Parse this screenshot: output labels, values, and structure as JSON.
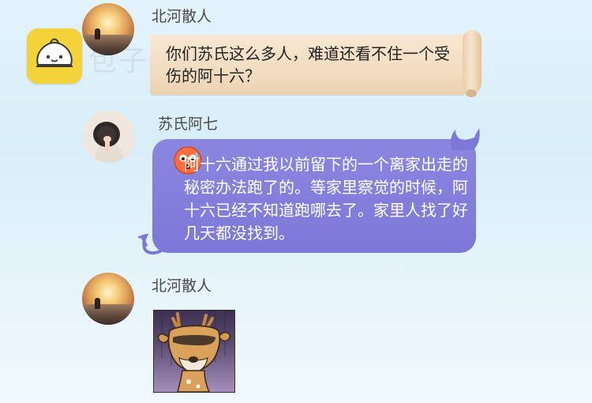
{
  "watermark": {
    "text": "包子漫画"
  },
  "messages": [
    {
      "sender": "北河散人",
      "text": "你们苏氏这么多人，难道还看不住一个受伤的阿十六？",
      "bubble_style": "scroll"
    },
    {
      "sender": "苏氏阿七",
      "text": "阿十六通过我以前留下的一个离家出走的秘密办法跑了的。等家里察觉的时候，阿十六已经不知道跑哪去了。家里人找了好几天都没找到。",
      "bubble_style": "purple-devil",
      "emoji": "worried-face-emoji"
    },
    {
      "sender": "北河散人",
      "sticker": "deer-sticker"
    }
  ],
  "colors": {
    "logo": "#f3d23a",
    "scroll_bubble": "#f2dcc0",
    "purple_bubble": "#7d78d8"
  }
}
